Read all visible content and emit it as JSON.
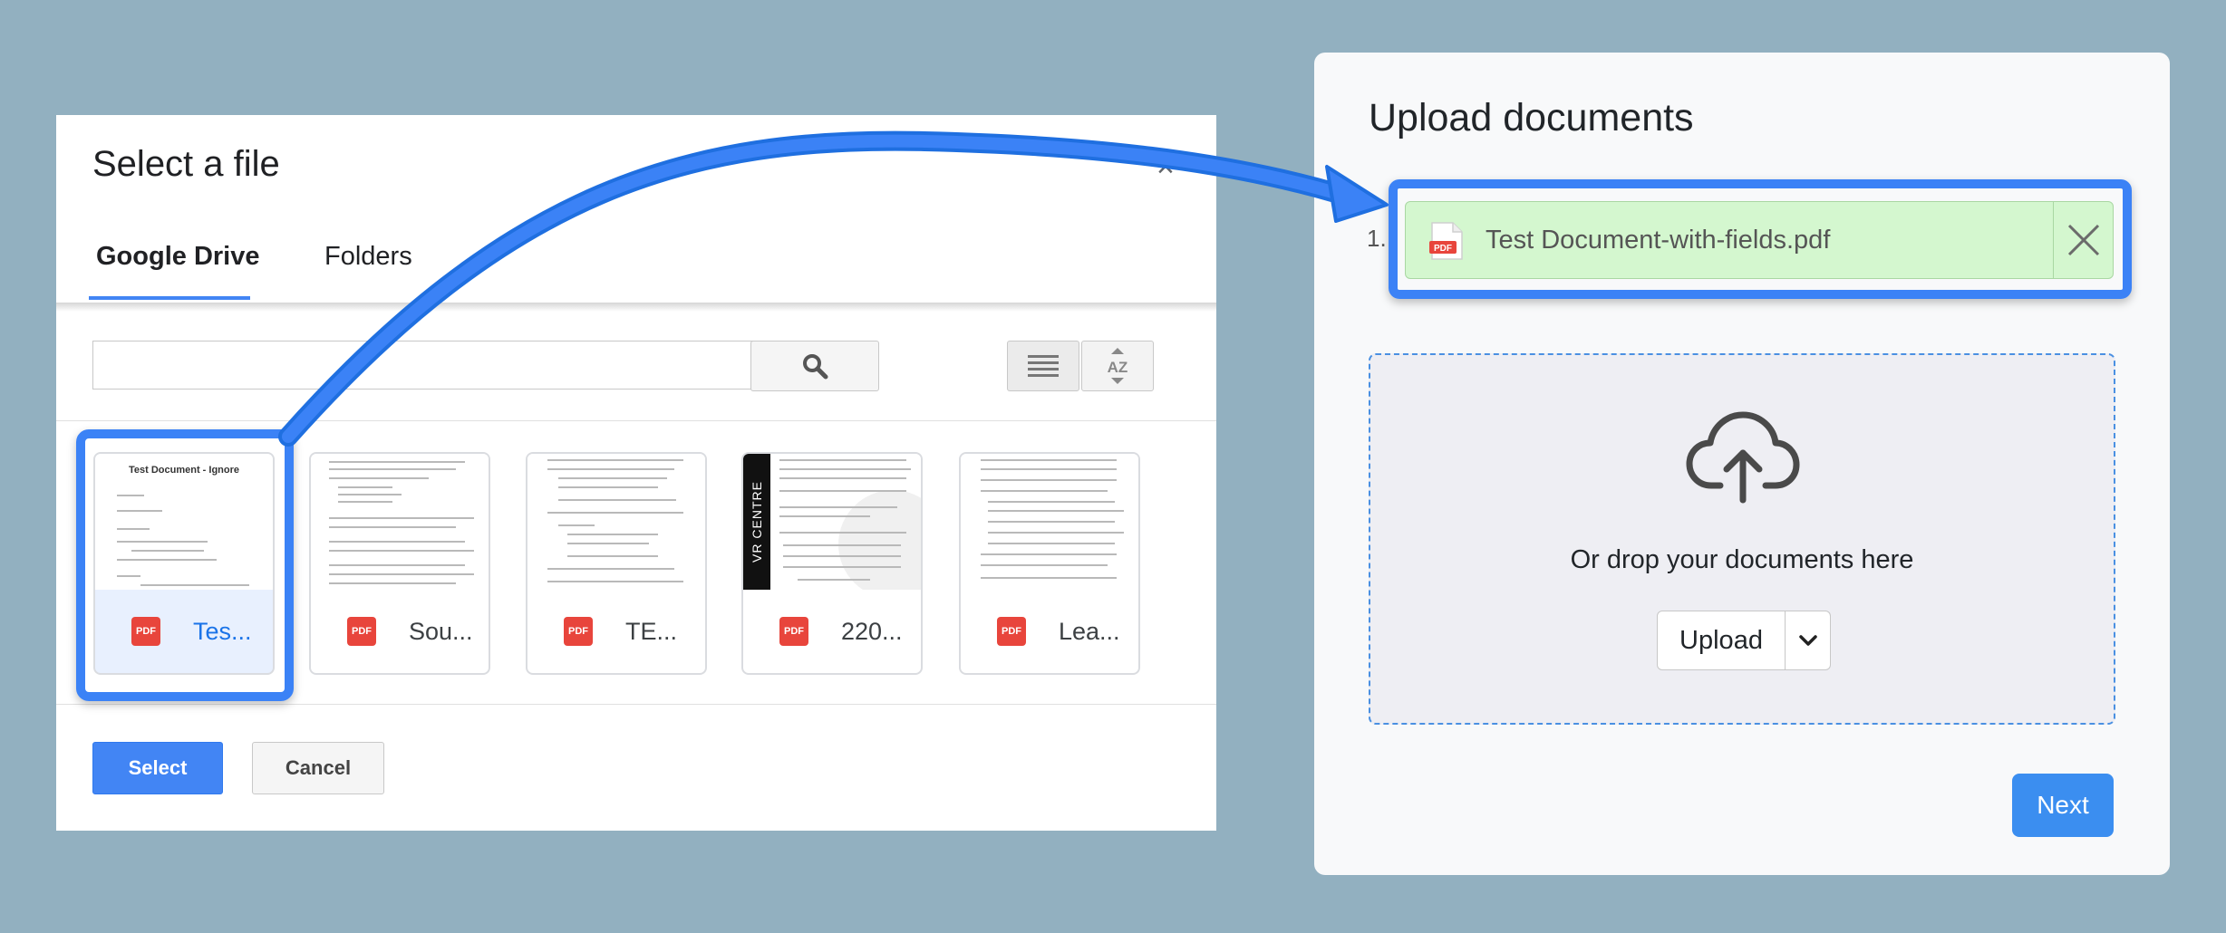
{
  "picker": {
    "title": "Select a file",
    "close_glyph": "×",
    "tabs": [
      {
        "label": "Google Drive",
        "active": true
      },
      {
        "label": "Folders",
        "active": false
      }
    ],
    "search": {
      "value": "",
      "placeholder": ""
    },
    "files": [
      {
        "name": "Tes...",
        "type": "PDF",
        "thumb_title": "Test Document - Ignore",
        "selected": true
      },
      {
        "name": "Sou...",
        "type": "PDF",
        "selected": false
      },
      {
        "name": "TE...",
        "type": "PDF",
        "selected": false
      },
      {
        "name": "220...",
        "type": "PDF",
        "thumb_band": "VR CENTRE",
        "selected": false
      },
      {
        "name": "Lea...",
        "type": "PDF",
        "selected": false
      }
    ],
    "select_label": "Select",
    "cancel_label": "Cancel",
    "sort_label": "AZ"
  },
  "upload": {
    "title": "Upload documents",
    "items": [
      {
        "number": "1.",
        "filename": "Test Document-with-fields.pdf",
        "type": "PDF"
      }
    ],
    "drop_text": "Or drop your documents here",
    "upload_label": "Upload",
    "next_label": "Next"
  },
  "colors": {
    "background": "#92b0c0",
    "highlight": "#3b82f6",
    "pdf_red": "#e8453c",
    "upload_item_green": "#d4f7cf",
    "primary_button": "#4285f4"
  },
  "icons": [
    "close-icon",
    "search-icon",
    "list-view-icon",
    "sort-az-icon",
    "pdf-icon",
    "remove-x-icon",
    "cloud-upload-icon",
    "chevron-down-icon",
    "curved-arrow"
  ]
}
